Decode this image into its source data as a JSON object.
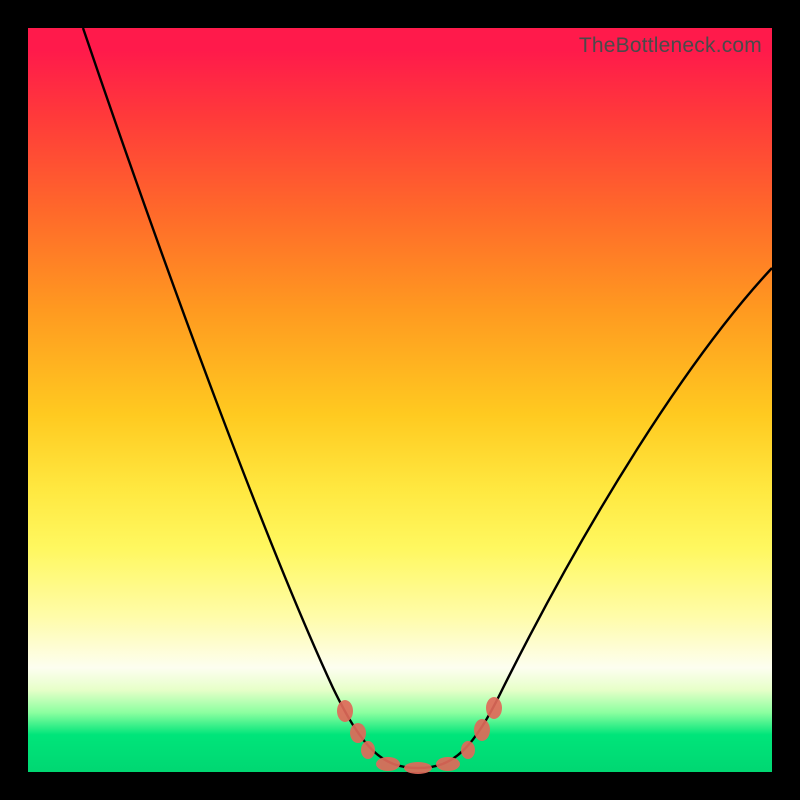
{
  "watermark": "TheBottleneck.com",
  "chart_data": {
    "type": "line",
    "title": "",
    "xlabel": "",
    "ylabel": "",
    "x": [
      0.0,
      0.05,
      0.09,
      0.14,
      0.18,
      0.23,
      0.27,
      0.32,
      0.36,
      0.4,
      0.44,
      0.48,
      0.52,
      0.56,
      0.6,
      0.64,
      0.68,
      0.73,
      0.77,
      0.82,
      0.86,
      0.91,
      0.95,
      1.0
    ],
    "series": [
      {
        "name": "curve",
        "values": [
          1.0,
          0.86,
          0.73,
          0.59,
          0.47,
          0.34,
          0.24,
          0.15,
          0.08,
          0.04,
          0.01,
          0.0,
          0.0,
          0.01,
          0.03,
          0.07,
          0.12,
          0.19,
          0.27,
          0.35,
          0.43,
          0.51,
          0.59,
          0.67
        ]
      },
      {
        "name": "markers",
        "x": [
          0.4,
          0.42,
          0.46,
          0.5,
          0.54,
          0.57,
          0.6,
          0.62
        ],
        "y": [
          0.04,
          0.025,
          0.01,
          0.004,
          0.008,
          0.018,
          0.035,
          0.055
        ]
      }
    ],
    "xlim": [
      0,
      1
    ],
    "ylim": [
      0,
      1
    ],
    "background_gradient": [
      "#ff1a4b",
      "#ff6a2a",
      "#ffca20",
      "#fffca8",
      "#00d772"
    ],
    "curve_color": "#000000",
    "marker_color": "#e06a5a"
  }
}
